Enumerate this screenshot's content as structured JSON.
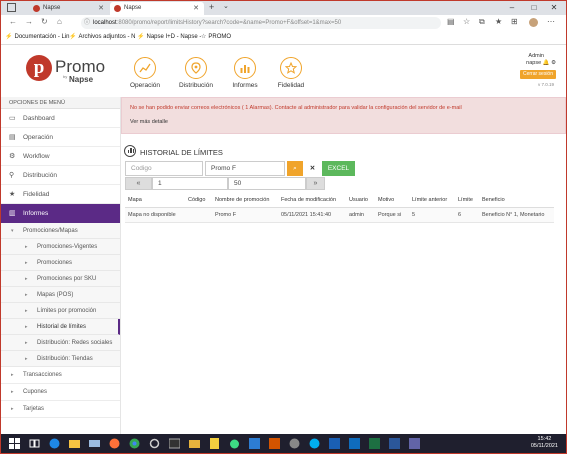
{
  "browser": {
    "tabs": [
      {
        "title": "Napse",
        "active": false
      },
      {
        "title": "Napse",
        "active": true
      }
    ],
    "url_host": "localhost",
    "url_path": ":8080/promo/report/limitsHistory?search?code=&name=Promo+F&offset=1&max=50",
    "bookmarks": [
      "Documentación - Lin",
      "Archivos adjuntos - N",
      "Napse I+D - Napse -",
      "PROMO"
    ]
  },
  "header": {
    "logo_letter": "p",
    "logo_text": "Promo",
    "logo_by": "by",
    "logo_brand": "Napse",
    "nav": [
      {
        "label": "Operación",
        "icon": "operation-icon"
      },
      {
        "label": "Distribución",
        "icon": "location-pin-icon"
      },
      {
        "label": "Informes",
        "icon": "bar-chart-icon"
      },
      {
        "label": "Fidelidad",
        "icon": "star-icon"
      }
    ],
    "user_role": "Admin",
    "user_name": "napse",
    "logout_label": "Cerrar sesión",
    "version": "v 7.0.19"
  },
  "sidebar": {
    "title": "OPCIONES DE MENÚ",
    "items": [
      {
        "label": "Dashboard",
        "icon": "laptop-icon"
      },
      {
        "label": "Operación",
        "icon": "stack-icon"
      },
      {
        "label": "Workflow",
        "icon": "gear-icon"
      },
      {
        "label": "Distribución",
        "icon": "pin-icon"
      },
      {
        "label": "Fidelidad",
        "icon": "star-icon"
      },
      {
        "label": "Informes",
        "icon": "bar-chart-icon"
      }
    ],
    "submenu": "Promociones/Mapas",
    "subsub": [
      "Promociones-Vigentes",
      "Promociones",
      "Promociones por SKU",
      "Mapas (POS)",
      "Límites por promoción",
      "Historial de límites",
      "Distribución: Redes sociales",
      "Distribución: Tiendas"
    ],
    "outer": [
      "Transacciones",
      "Cupones",
      "Tarjetas"
    ]
  },
  "alert": {
    "message": "No se han podido enviar correos electrónicos ( 1 Alarmas). Contacte al administrador para validar la configuración del servidor de e-mail",
    "link": "Ver más detalle"
  },
  "section": {
    "title": "HISTORIAL DE LÍMITES"
  },
  "filters": {
    "code_placeholder": "Codigo",
    "name_value": "Promo F",
    "search_icon": "search-icon",
    "clear_icon": "close-icon",
    "excel_label": "EXCEL",
    "offset_value": "1",
    "max_value": "50"
  },
  "table": {
    "columns": [
      "Mapa",
      "Código",
      "Nombre de promoción",
      "Fecha de modificación",
      "Usuario",
      "Motivo",
      "Límite anterior",
      "Límite",
      "Beneficio"
    ],
    "rows": [
      [
        "Mapa no disponible",
        "",
        "Promo F",
        "05/11/2021 15:41:40",
        "admin",
        "Porque si",
        "5",
        "6",
        "Beneficio N° 1, Monetario"
      ]
    ]
  },
  "taskbar": {
    "time": "15:42",
    "date": "05/11/2021"
  },
  "colors": {
    "accent_orange": "#f0a42b",
    "sidebar_active": "#5b2a86",
    "excel_green": "#5cb85c",
    "alert_text": "#c0392b"
  }
}
